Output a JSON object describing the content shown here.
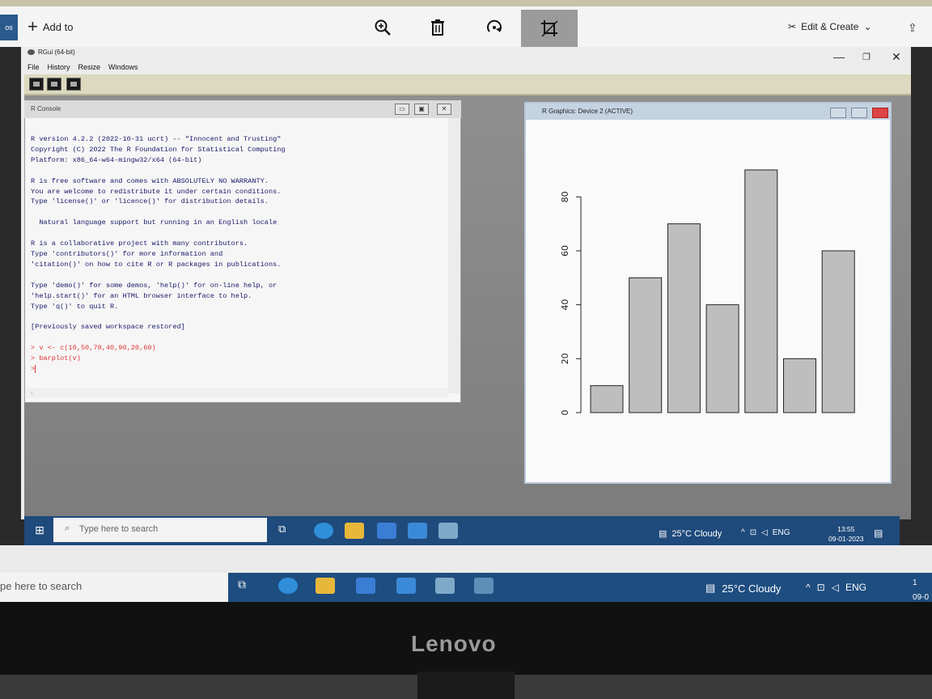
{
  "photos_app": {
    "left_stub_label": "os",
    "add_to_label": "Add to",
    "edit_create_label": "Edit & Create"
  },
  "rgui": {
    "title": "RGui (64-bit)",
    "menu": [
      "File",
      "History",
      "Resize",
      "Windows"
    ]
  },
  "console": {
    "title": "R Console",
    "lines": [
      "R version 4.2.2 (2022-10-31 ucrt) -- \"Innocent and Trusting\"",
      "Copyright (C) 2022 The R Foundation for Statistical Computing",
      "Platform: x86_64-w64-mingw32/x64 (64-bit)",
      "",
      "R is free software and comes with ABSOLUTELY NO WARRANTY.",
      "You are welcome to redistribute it under certain conditions.",
      "Type 'license()' or 'licence()' for distribution details.",
      "",
      "  Natural language support but running in an English locale",
      "",
      "R is a collaborative project with many contributors.",
      "Type 'contributors()' for more information and",
      "'citation()' on how to cite R or R packages in publications.",
      "",
      "Type 'demo()' for some demos, 'help()' for on-line help, or",
      "'help.start()' for an HTML browser interface to help.",
      "Type 'q()' to quit R.",
      "",
      "[Previously saved workspace restored]",
      ""
    ],
    "commands": [
      "> v <- c(10,50,70,40,90,20,60)",
      "> barplot(v)",
      ">"
    ]
  },
  "graphics": {
    "title": "R Graphics: Device 2 (ACTIVE)"
  },
  "chart_data": {
    "type": "bar",
    "categories": [
      "",
      "",
      "",
      "",
      "",
      "",
      ""
    ],
    "values": [
      10,
      50,
      70,
      40,
      90,
      20,
      60
    ],
    "yticks": [
      "0",
      "20",
      "40",
      "60",
      "80"
    ],
    "ylim": [
      0,
      90
    ],
    "bar_color": "#bebebe",
    "grid": false
  },
  "taskbar_inner": {
    "search_placeholder": "Type here to search",
    "weather": "25°C  Cloudy",
    "lang": "ENG",
    "time": "13:55",
    "date": "09-01-2023"
  },
  "taskbar_outer": {
    "search_placeholder": "pe here to search",
    "weather": "25°C  Cloudy",
    "lang": "ENG",
    "time": "1",
    "date": "09-0"
  },
  "monitor": {
    "brand": "Lenovo"
  }
}
